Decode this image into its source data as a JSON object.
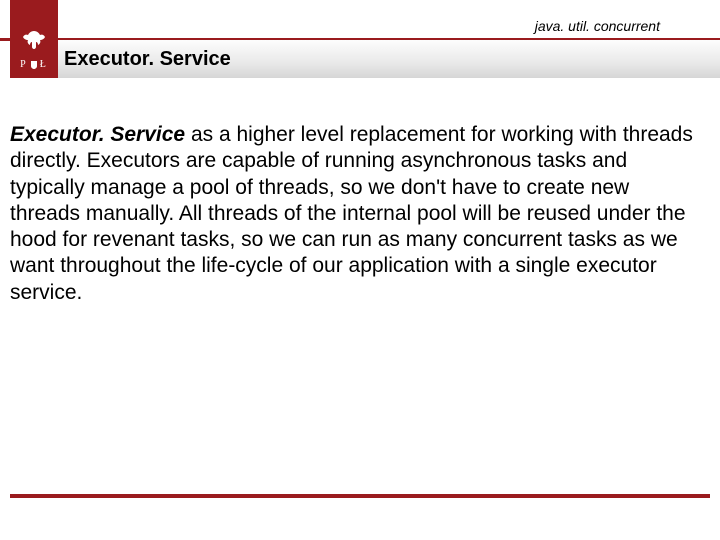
{
  "header": {
    "package_label": "java. util. concurrent",
    "title": "Executor. Service",
    "logo_letters_left": "P",
    "logo_letters_right": "Ł"
  },
  "body": {
    "lead": "Executor. Service",
    "rest": " as a higher level replacement for working with threads directly. Executors are capable of running asynchronous tasks and typically manage a pool of threads, so we don't have to create new threads manually. All threads of the internal pool will be reused under the hood for revenant tasks, so we can run as many concurrent tasks as we want throughout the life-cycle of our application with a single executor service."
  },
  "colors": {
    "accent": "#9a1b1e"
  }
}
